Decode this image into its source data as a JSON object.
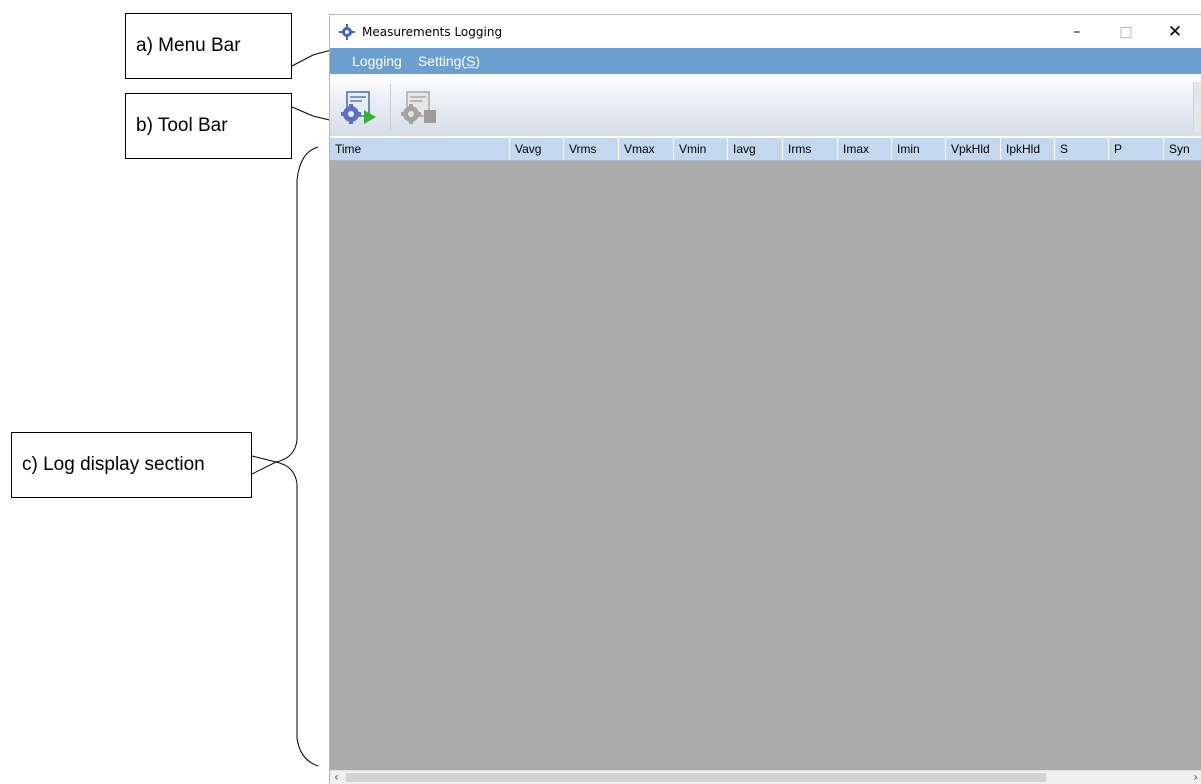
{
  "callouts": {
    "menu_bar": "a) Menu Bar",
    "tool_bar": "b) Tool Bar",
    "log_display": "c) Log display section"
  },
  "window": {
    "title": "Measurements Logging",
    "icon": "app-icon",
    "controls": {
      "minimize": "–",
      "maximize": "□",
      "close": "✕"
    }
  },
  "menu": {
    "items": [
      "Logging",
      "Setting(S)"
    ]
  },
  "toolbar": {
    "buttons": [
      {
        "icon": "start-logging-icon",
        "enabled": true
      },
      {
        "icon": "stop-logging-icon",
        "enabled": false
      }
    ]
  },
  "log_table": {
    "columns": [
      "Time",
      "Vavg",
      "Vrms",
      "Vmax",
      "Vmin",
      "Iavg",
      "Irms",
      "Imax",
      "Imin",
      "VpkHld",
      "IpkHld",
      "S",
      "P",
      "Syn"
    ],
    "rows": []
  },
  "scrollbar": {
    "left_arrow": "‹",
    "right_arrow": "›"
  },
  "colors": {
    "menubar": "#6b9fd0",
    "header": "#c3d8ee",
    "grid_background": "#ababab"
  }
}
